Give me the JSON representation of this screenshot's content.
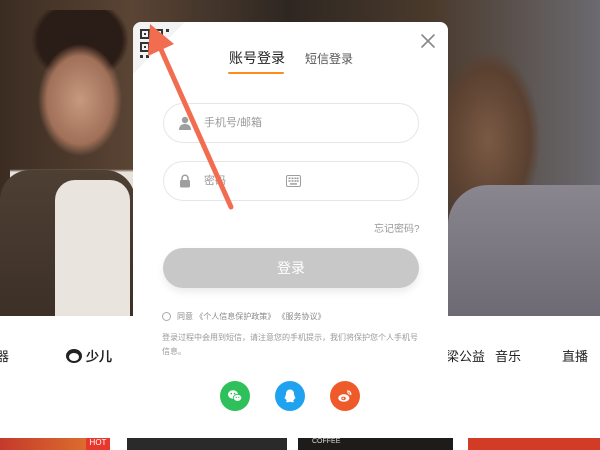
{
  "background": {
    "categories": {
      "partial_left": "器",
      "kids": "少儿",
      "public_welfare": "梁公益",
      "music": "音乐",
      "live": "直播"
    },
    "thumbnails": {
      "hot_badge": "HOT",
      "coffee_text": "COFFEE"
    }
  },
  "modal": {
    "tabs": [
      {
        "label": "账号登录",
        "active": true
      },
      {
        "label": "短信登录",
        "active": false
      }
    ],
    "phone_field": {
      "placeholder": "手机号/邮箱",
      "value": ""
    },
    "password_field": {
      "placeholder": "密码",
      "value": ""
    },
    "forgot_password": "忘记密码?",
    "login_button": "登录",
    "agreement": {
      "prefix": "同意",
      "privacy_policy": "《个人信息保护政策》",
      "service_agreement": "《服务协议》"
    },
    "notice": "登录过程中会用到短信，请注意您的手机提示，我们将保护您个人手机号信息。",
    "social_logins": [
      "wechat-icon",
      "qq-icon",
      "weibo-icon"
    ]
  },
  "colors": {
    "accent": "#ff8a1f",
    "login_button_disabled": "#c8c8c8",
    "wechat": "#2ec05a",
    "qq": "#1fa3f0",
    "weibo": "#ef5a2a",
    "annotation_arrow": "#f26c4f"
  }
}
